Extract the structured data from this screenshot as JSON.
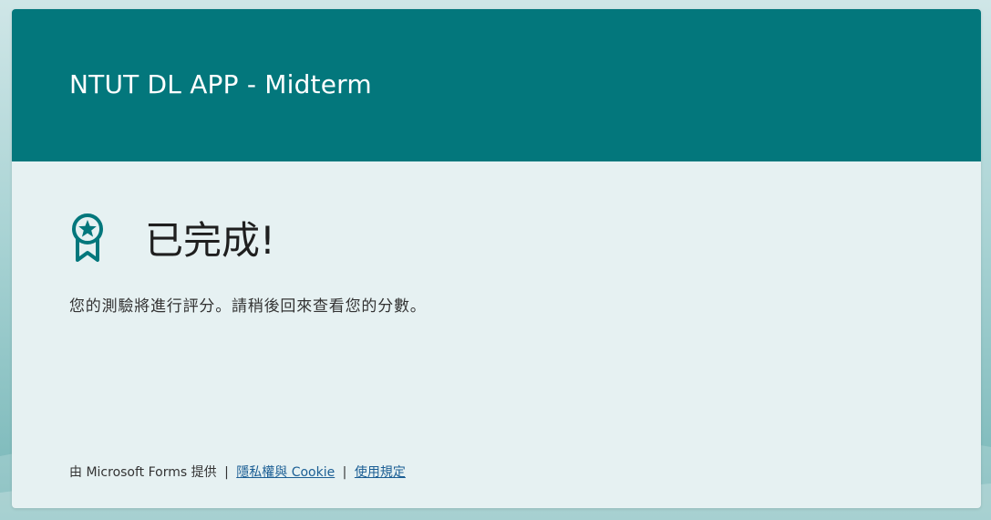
{
  "form": {
    "title": "NTUT DL APP - Midterm"
  },
  "completion": {
    "icon": "award-ribbon-icon",
    "heading": "已完成!",
    "message": "您的測驗將進行評分。請稍後回來查看您的分數。"
  },
  "footer": {
    "powered_by": "由 Microsoft Forms 提供",
    "separator": "|",
    "privacy_link": "隱私權與 Cookie",
    "terms_link": "使用規定"
  },
  "colors": {
    "header_bg": "#03777c",
    "card_bg": "#e6f1f2",
    "accent": "#03777c",
    "link": "#1b5e94"
  }
}
